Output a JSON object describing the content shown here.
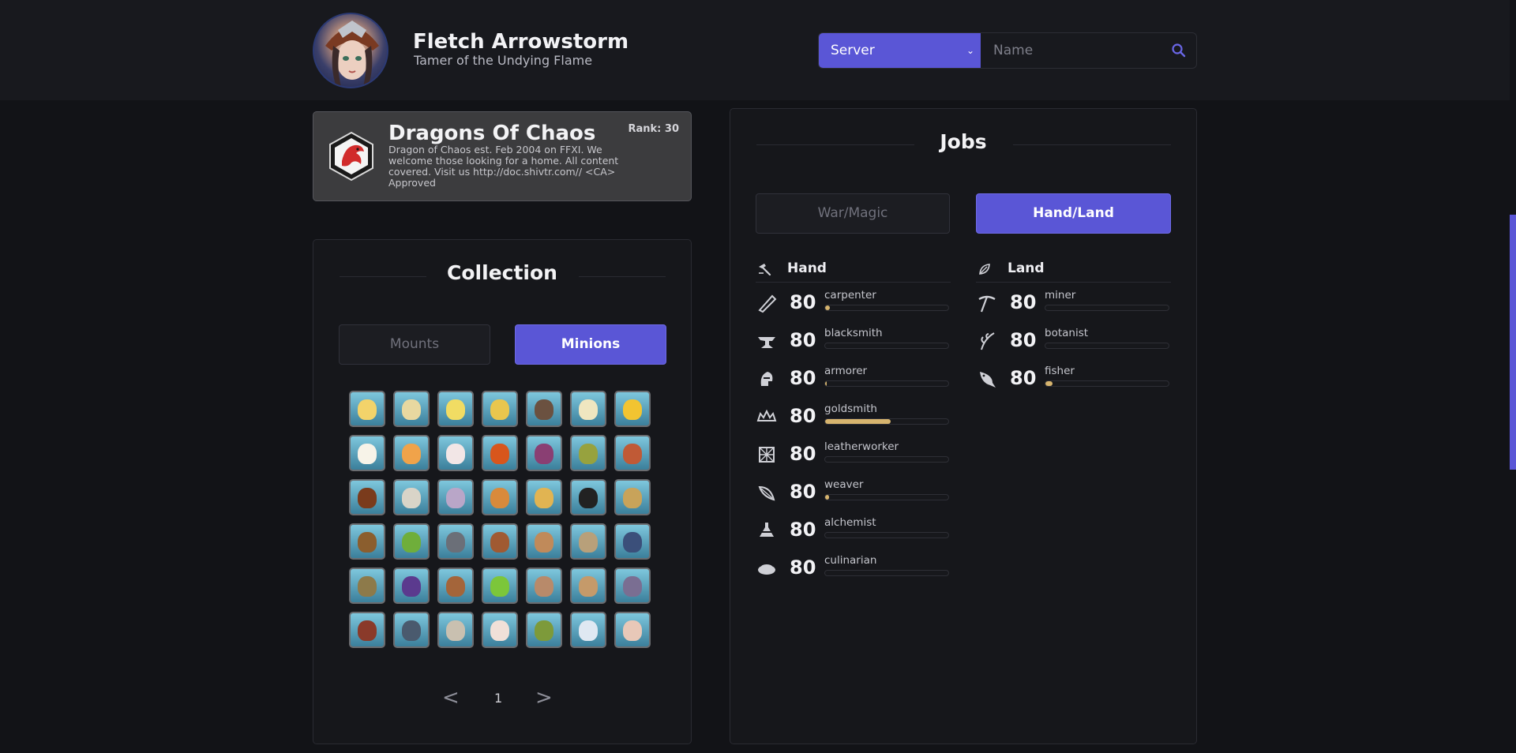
{
  "character": {
    "name": "Fletch Arrowstorm",
    "title": "Tamer of the Undying Flame"
  },
  "search": {
    "server_label": "Server",
    "name_placeholder": "Name"
  },
  "free_company": {
    "name": "Dragons Of Chaos",
    "rank": "Rank: 30",
    "description": "Dragon of Chaos est. Feb 2004 on FFXI. We welcome those looking for a home. All content covered. Visit us http://doc.shivtr.com// <CA> Approved"
  },
  "collection": {
    "title": "Collection",
    "tabs": [
      {
        "label": "Mounts",
        "active": false
      },
      {
        "label": "Minions",
        "active": true
      }
    ],
    "minions": [
      "#f3d36a",
      "#e8d8a0",
      "#f1dc63",
      "#e9c64e",
      "#6b5140",
      "#efe6c0",
      "#f2c431",
      "#f7f3e8",
      "#f0a34a",
      "#f2e6e6",
      "#d8561c",
      "#8a3f73",
      "#97a23e",
      "#c05a36",
      "#7a3b1c",
      "#d9d4c8",
      "#b9a6c8",
      "#d88a3c",
      "#e1b452",
      "#222222",
      "#c8a35a",
      "#8b5e2e",
      "#6fae3b",
      "#6b6f78",
      "#a05a32",
      "#c08a5a",
      "#b8a07a",
      "#3b4f7a",
      "#8d7a4a",
      "#5b3a8e",
      "#a4653a",
      "#7cc63a",
      "#b88a6a",
      "#c59a6a",
      "#7a6e92",
      "#8a3a2a",
      "#4a5a6e",
      "#c9c0b0",
      "#f0e0d8",
      "#7d9a3a",
      "#dfe8f2",
      "#e8c8b8"
    ],
    "pagination": {
      "prev": "<",
      "page": "1",
      "next": ">"
    }
  },
  "jobs": {
    "title": "Jobs",
    "tabs": [
      {
        "label": "War/Magic",
        "active": false
      },
      {
        "label": "Hand/Land",
        "active": true
      }
    ],
    "hand": {
      "label": "Hand",
      "icon": "hammer-icon",
      "items": [
        {
          "name": "carpenter",
          "level": "80",
          "icon": "saw-icon",
          "progress": 0.04
        },
        {
          "name": "blacksmith",
          "level": "80",
          "icon": "anvil-icon",
          "progress": 0.0
        },
        {
          "name": "armorer",
          "level": "80",
          "icon": "helmet-icon",
          "progress": 0.01
        },
        {
          "name": "goldsmith",
          "level": "80",
          "icon": "crown-icon",
          "progress": 0.53
        },
        {
          "name": "leatherworker",
          "level": "80",
          "icon": "leather-icon",
          "progress": 0.0
        },
        {
          "name": "weaver",
          "level": "80",
          "icon": "needle-icon",
          "progress": 0.03
        },
        {
          "name": "alchemist",
          "level": "80",
          "icon": "flask-icon",
          "progress": 0.0
        },
        {
          "name": "culinarian",
          "level": "80",
          "icon": "pot-icon",
          "progress": 0.0
        }
      ]
    },
    "land": {
      "label": "Land",
      "icon": "leaf-icon",
      "items": [
        {
          "name": "miner",
          "level": "80",
          "icon": "pickaxe-icon",
          "progress": 0.0
        },
        {
          "name": "botanist",
          "level": "80",
          "icon": "plant-icon",
          "progress": 0.0
        },
        {
          "name": "fisher",
          "level": "80",
          "icon": "fish-icon",
          "progress": 0.06
        }
      ]
    }
  }
}
